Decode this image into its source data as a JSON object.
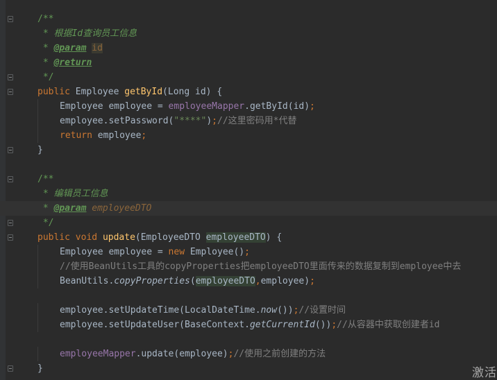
{
  "editor": {
    "lines": [
      {
        "fold": true,
        "parts": [
          {
            "t": "/**",
            "c": "doc-plain"
          }
        ]
      },
      {
        "fold": false,
        "parts": [
          {
            "t": " * ",
            "c": "doc-plain"
          },
          {
            "t": "根据Id查询员工信息",
            "c": "doc"
          }
        ]
      },
      {
        "fold": false,
        "parts": [
          {
            "t": " * ",
            "c": "doc-plain"
          },
          {
            "t": "@param",
            "c": "tag"
          },
          {
            "t": " ",
            "c": "doc-plain"
          },
          {
            "t": "id",
            "c": "tagval-hl"
          }
        ]
      },
      {
        "fold": false,
        "parts": [
          {
            "t": " * ",
            "c": "doc-plain"
          },
          {
            "t": "@return",
            "c": "tag"
          }
        ]
      },
      {
        "fold": true,
        "parts": [
          {
            "t": " */",
            "c": "doc-plain"
          }
        ]
      },
      {
        "fold": true,
        "parts": [
          {
            "t": "public ",
            "c": "kw"
          },
          {
            "t": "Employee ",
            "c": ""
          },
          {
            "t": "getById",
            "c": "fn"
          },
          {
            "t": "(Long id) {",
            "c": ""
          }
        ]
      },
      {
        "fold": false,
        "indent": 1,
        "parts": [
          {
            "t": "Employee employee = ",
            "c": ""
          },
          {
            "t": "employeeMapper",
            "c": "field"
          },
          {
            "t": ".getById(id)",
            "c": ""
          },
          {
            "t": ";",
            "c": "kw"
          }
        ]
      },
      {
        "fold": false,
        "indent": 1,
        "parts": [
          {
            "t": "employee.setPassword(",
            "c": ""
          },
          {
            "t": "\"****\"",
            "c": "str"
          },
          {
            "t": ")",
            "c": ""
          },
          {
            "t": ";",
            "c": "kw"
          },
          {
            "t": "//这里密码用*代替",
            "c": "cmt"
          }
        ]
      },
      {
        "fold": false,
        "indent": 1,
        "parts": [
          {
            "t": "return ",
            "c": "kw"
          },
          {
            "t": "employee",
            "c": ""
          },
          {
            "t": ";",
            "c": "kw"
          }
        ]
      },
      {
        "fold": true,
        "parts": [
          {
            "t": "}",
            "c": ""
          }
        ]
      },
      {
        "fold": false,
        "parts": []
      },
      {
        "fold": true,
        "parts": [
          {
            "t": "/**",
            "c": "doc-plain"
          }
        ]
      },
      {
        "fold": false,
        "parts": [
          {
            "t": " * ",
            "c": "doc-plain"
          },
          {
            "t": "编辑员工信息",
            "c": "doc"
          }
        ]
      },
      {
        "fold": false,
        "current": true,
        "parts": [
          {
            "t": " * ",
            "c": "doc-plain"
          },
          {
            "t": "@param",
            "c": "tag"
          },
          {
            "t": " ",
            "c": "doc-plain"
          },
          {
            "t": "employeeDTO",
            "c": "tagval"
          }
        ]
      },
      {
        "fold": true,
        "parts": [
          {
            "t": " */",
            "c": "doc-plain"
          }
        ]
      },
      {
        "fold": true,
        "parts": [
          {
            "t": "public ",
            "c": "kw"
          },
          {
            "t": "void ",
            "c": "kw"
          },
          {
            "t": "update",
            "c": "fn"
          },
          {
            "t": "(EmployeeDTO ",
            "c": ""
          },
          {
            "t": "employeeDTO",
            "c": "param-hl"
          },
          {
            "t": ") {",
            "c": ""
          }
        ]
      },
      {
        "fold": false,
        "indent": 1,
        "parts": [
          {
            "t": "Employee employee = ",
            "c": ""
          },
          {
            "t": "new ",
            "c": "kw"
          },
          {
            "t": "Employee()",
            "c": ""
          },
          {
            "t": ";",
            "c": "kw"
          }
        ]
      },
      {
        "fold": false,
        "indent": 1,
        "parts": [
          {
            "t": "//使用BeanUtils工具的copyProperties把employeeDTO里面传来的数据复制到employee中去",
            "c": "cmt"
          }
        ]
      },
      {
        "fold": false,
        "indent": 1,
        "parts": [
          {
            "t": "BeanUtils.",
            "c": ""
          },
          {
            "t": "copyProperties",
            "c": "ital"
          },
          {
            "t": "(",
            "c": ""
          },
          {
            "t": "employeeDTO",
            "c": "param-hl"
          },
          {
            "t": ",",
            "c": "kw"
          },
          {
            "t": "employee)",
            "c": ""
          },
          {
            "t": ";",
            "c": "kw"
          }
        ]
      },
      {
        "fold": false,
        "parts": []
      },
      {
        "fold": false,
        "indent": 1,
        "parts": [
          {
            "t": "employee.setUpdateTime(LocalDateTime.",
            "c": ""
          },
          {
            "t": "now",
            "c": "ital"
          },
          {
            "t": "())",
            "c": ""
          },
          {
            "t": ";",
            "c": "kw"
          },
          {
            "t": "//设置时间",
            "c": "cmt"
          }
        ]
      },
      {
        "fold": false,
        "indent": 1,
        "parts": [
          {
            "t": "employee.setUpdateUser(BaseContext.",
            "c": ""
          },
          {
            "t": "getCurrentId",
            "c": "ital"
          },
          {
            "t": "())",
            "c": ""
          },
          {
            "t": ";",
            "c": "kw"
          },
          {
            "t": "//从容器中获取创建者id",
            "c": "cmt"
          }
        ]
      },
      {
        "fold": false,
        "parts": []
      },
      {
        "fold": false,
        "indent": 1,
        "parts": [
          {
            "t": "employeeMapper",
            "c": "field"
          },
          {
            "t": ".update(employee)",
            "c": ""
          },
          {
            "t": ";",
            "c": "kw"
          },
          {
            "t": "//使用之前创建的方法",
            "c": "cmt"
          }
        ]
      },
      {
        "fold": true,
        "parts": [
          {
            "t": "}",
            "c": ""
          }
        ]
      }
    ]
  },
  "watermark": "激活"
}
